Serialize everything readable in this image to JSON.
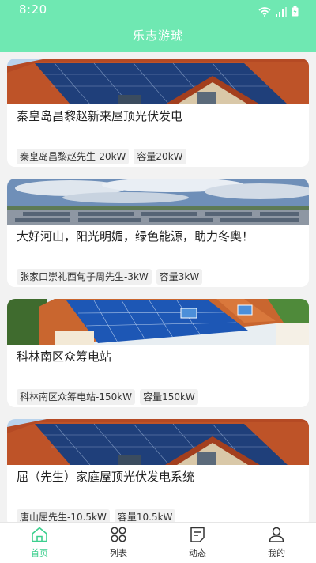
{
  "status": {
    "time": "8:20"
  },
  "header": {
    "title": "乐志游琥"
  },
  "cards": [
    {
      "title": "秦皇岛昌黎赵新来屋顶光伏发电",
      "tags": [
        "秦皇岛昌黎赵先生-20kW",
        "容量20kW"
      ],
      "image": "rooftop-solar-panels"
    },
    {
      "title": "大好河山，阳光明媚，绿色能源，助力冬奥！",
      "tags": [
        "张家口崇礼西甸子周先生-3kW",
        "容量3kW"
      ],
      "image": "solar-field-under-sky"
    },
    {
      "title": "科林南区众筹电站",
      "tags": [
        "科林南区众筹电站-150kW",
        "容量150kW"
      ],
      "image": "house-roof-solar"
    },
    {
      "title": "屈（先生）家庭屋顶光伏发电系统",
      "tags": [
        "唐山屈先生-10.5kW",
        "容量10.5kW"
      ],
      "image": "rooftop-solar-panels"
    }
  ],
  "tabbar": {
    "tabs": [
      {
        "label": "首页",
        "icon": "home-icon",
        "active": true
      },
      {
        "label": "列表",
        "icon": "grid-icon",
        "active": false
      },
      {
        "label": "动态",
        "icon": "feed-icon",
        "active": false
      },
      {
        "label": "我的",
        "icon": "user-icon",
        "active": false
      }
    ]
  },
  "colors": {
    "accent": "#6fe8b2",
    "tab_active": "#3ccf8e"
  }
}
